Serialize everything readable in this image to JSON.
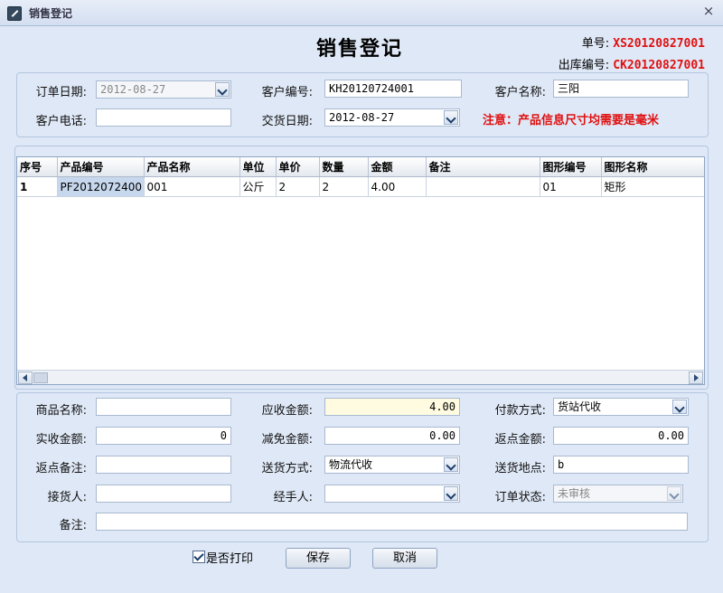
{
  "window": {
    "title": "销售登记",
    "close": "×"
  },
  "form": {
    "title": "销售登记",
    "order_no_label": "单号:",
    "order_no": "XS20120827001",
    "outbound_no_label": "出库编号:",
    "outbound_no": "CK20120827001"
  },
  "header": {
    "order_date_label": "订单日期:",
    "order_date": "2012-08-27",
    "customer_no_label": "客户编号:",
    "customer_no": "KH20120724001",
    "customer_name_label": "客户名称:",
    "customer_name": "三阳",
    "phone_label": "客户电话:",
    "phone": "",
    "delivery_date_label": "交货日期:",
    "delivery_date": "2012-08-27",
    "notice": "注意：产品信息尺寸均需要是毫米"
  },
  "grid": {
    "columns": [
      "序号",
      "产品编号",
      "产品名称",
      "单位",
      "单价",
      "数量",
      "金额",
      "备注",
      "图形编号",
      "图形名称"
    ],
    "rows": [
      [
        "1",
        "PF2012072400",
        "001",
        "公斤",
        "2",
        "2",
        "4.00",
        "",
        "01",
        "矩形"
      ]
    ]
  },
  "footer": {
    "goods_name_label": "商品名称:",
    "goods_name": "",
    "receivable_label": "应收金额:",
    "receivable": "4.00",
    "payment_label": "付款方式:",
    "payment": "货站代收",
    "received_label": "实收金额:",
    "received": "0",
    "discount_label": "减免金额:",
    "discount": "0.00",
    "rebate_label": "返点金额:",
    "rebate": "0.00",
    "rebate_note_label": "返点备注:",
    "rebate_note": "",
    "delivery_method_label": "送货方式:",
    "delivery_method": "物流代收",
    "delivery_place_label": "送货地点:",
    "delivery_place": "b",
    "receiver_label": "接货人:",
    "receiver": "",
    "handler_label": "经手人:",
    "handler": "",
    "status_label": "订单状态:",
    "status": "未审核",
    "remark_label": "备注:",
    "remark": ""
  },
  "actions": {
    "print_label": "是否打印",
    "print_checked": true,
    "save": "保存",
    "cancel": "取消"
  }
}
